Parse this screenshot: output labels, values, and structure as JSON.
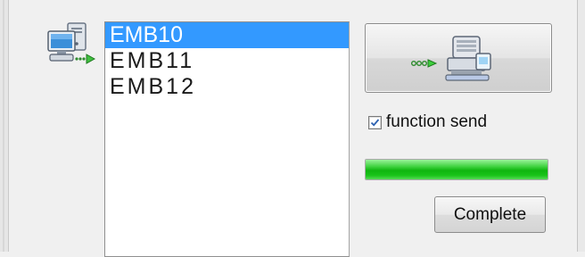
{
  "devices": {
    "items": [
      {
        "label": "EMB10",
        "selected": true
      },
      {
        "label": "EMB11",
        "selected": false
      },
      {
        "label": "EMB12",
        "selected": false
      }
    ]
  },
  "icons": {
    "computer": "computer-transfer-icon",
    "send": "send-to-embroidery-machine-icon",
    "check": "checkmark-icon"
  },
  "options": {
    "function_send_label": "function send",
    "function_send_checked": true
  },
  "progress": {
    "fraction": 1.0,
    "color": "#1fc01f"
  },
  "actions": {
    "complete_label": "Complete"
  },
  "colors": {
    "selection": "#3399ff",
    "background": "#f0f0f0"
  }
}
